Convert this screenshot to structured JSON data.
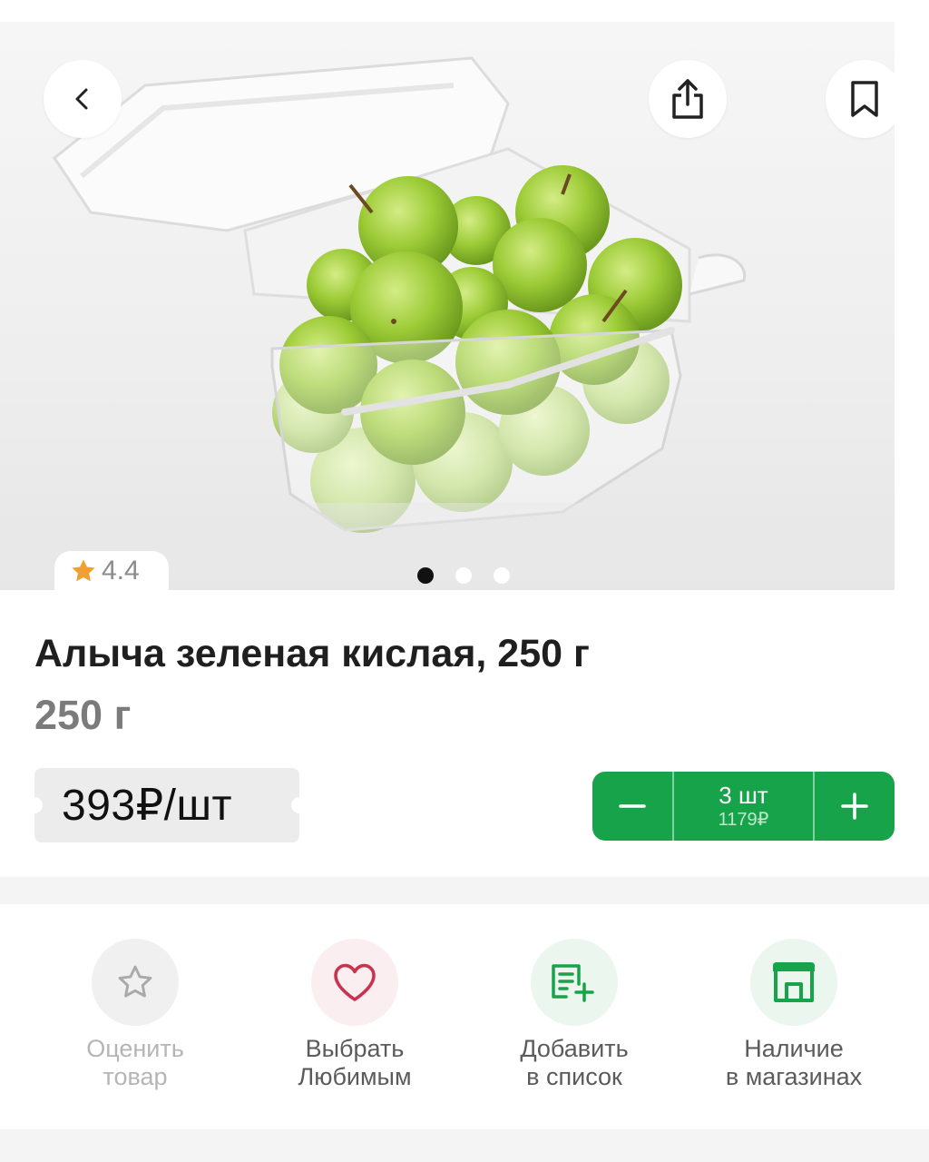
{
  "gallery": {
    "slides_total": 3,
    "active_slide": 1
  },
  "icons": {
    "back": "chevron-left-icon",
    "share": "share-icon",
    "bookmark": "bookmark-icon",
    "rating": "star-icon",
    "minus": "minus-icon",
    "plus": "plus-icon",
    "rate": "star-outline-icon",
    "favorite": "heart-icon",
    "add_list": "list-add-icon",
    "stores": "store-icon"
  },
  "product": {
    "rating": "4.4",
    "title": "Алыча зеленая кислая, 250 г",
    "weight": "250 г",
    "price": "393₽/шт"
  },
  "cart": {
    "quantity": "3 шт",
    "total": "1179₽"
  },
  "actions": [
    {
      "label": "Оценить\nтовар"
    },
    {
      "label": "Выбрать\nЛюбимым"
    },
    {
      "label": "Добавить\nв список"
    },
    {
      "label": "Наличие\nв магазинах"
    }
  ],
  "colors": {
    "accent_green": "#17a34a",
    "rating_star": "#f0a030",
    "favorite_red": "#c8344f"
  }
}
